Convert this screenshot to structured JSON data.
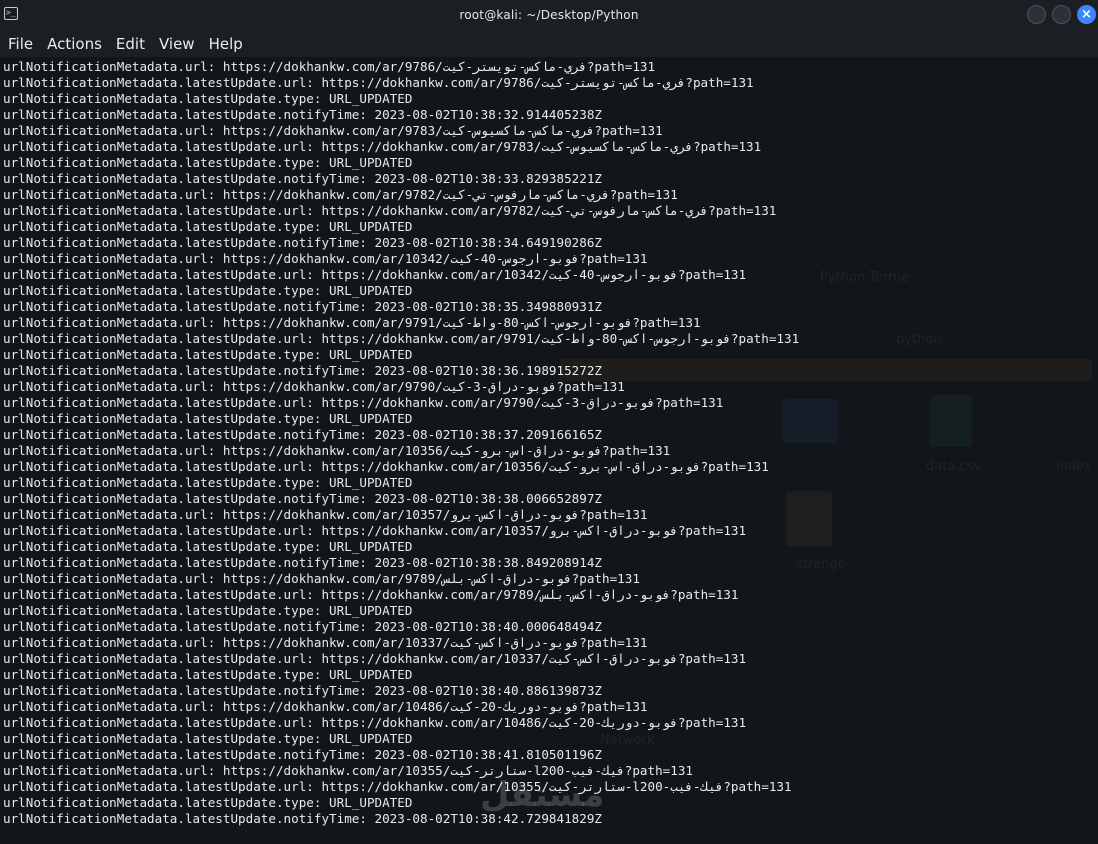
{
  "window": {
    "title": "root@kali: ~/Desktop/Python",
    "terminal_icon": "terminal-icon",
    "close_glyph": "×"
  },
  "menu": [
    "File",
    "Actions",
    "Edit",
    "View",
    "Help"
  ],
  "background_ghost_text": {
    "wallpaper_1": "Python Terroe",
    "path_hint": "python",
    "folder_label": "data.csv",
    "folder2_label": "index",
    "file_label": "strange-",
    "status_hint": "Network"
  },
  "watermark": "مستقل",
  "terminal_lines": [
    "urlNotificationMetadata.url: https://dokhankw.com/ar/9786/فري-ماكس-تويستر-كيت?path=131",
    "urlNotificationMetadata.latestUpdate.url: https://dokhankw.com/ar/9786/فري-ماكس-تويستر-كيت?path=131",
    "urlNotificationMetadata.latestUpdate.type: URL_UPDATED",
    "urlNotificationMetadata.latestUpdate.notifyTime: 2023-08-02T10:38:32.914405238Z",
    "urlNotificationMetadata.url: https://dokhankw.com/ar/9783/فري-ماكس-ماكسيوس-كيت?path=131",
    "urlNotificationMetadata.latestUpdate.url: https://dokhankw.com/ar/9783/فري-ماكس-ماكسيوس-كيت?path=131",
    "urlNotificationMetadata.latestUpdate.type: URL_UPDATED",
    "urlNotificationMetadata.latestUpdate.notifyTime: 2023-08-02T10:38:33.829385221Z",
    "urlNotificationMetadata.url: https://dokhankw.com/ar/9782/فري-ماكس-مارفوس-تي-كيت?path=131",
    "urlNotificationMetadata.latestUpdate.url: https://dokhankw.com/ar/9782/فري-ماكس-مارفوس-تي-كيت?path=131",
    "urlNotificationMetadata.latestUpdate.type: URL_UPDATED",
    "urlNotificationMetadata.latestUpdate.notifyTime: 2023-08-02T10:38:34.649190286Z",
    "urlNotificationMetadata.url: https://dokhankw.com/ar/10342/فوبو-ارجوس-40-كيت?path=131",
    "urlNotificationMetadata.latestUpdate.url: https://dokhankw.com/ar/10342/فوبو-ارجوس-40-كيت?path=131",
    "urlNotificationMetadata.latestUpdate.type: URL_UPDATED",
    "urlNotificationMetadata.latestUpdate.notifyTime: 2023-08-02T10:38:35.349880931Z",
    "urlNotificationMetadata.url: https://dokhankw.com/ar/9791/فوبو-ارجوس-اكس-80-واط-كيت?path=131",
    "urlNotificationMetadata.latestUpdate.url: https://dokhankw.com/ar/9791/فوبو-ارجوس-اكس-80-واط-كيت?path=131",
    "urlNotificationMetadata.latestUpdate.type: URL_UPDATED",
    "urlNotificationMetadata.latestUpdate.notifyTime: 2023-08-02T10:38:36.198915272Z",
    "urlNotificationMetadata.url: https://dokhankw.com/ar/9790/فوبو-دراق-3-كيت?path=131",
    "urlNotificationMetadata.latestUpdate.url: https://dokhankw.com/ar/9790/فوبو-دراق-3-كيت?path=131",
    "urlNotificationMetadata.latestUpdate.type: URL_UPDATED",
    "urlNotificationMetadata.latestUpdate.notifyTime: 2023-08-02T10:38:37.209166165Z",
    "urlNotificationMetadata.url: https://dokhankw.com/ar/10356/فوبو-دراق-اس-برو-كيت?path=131",
    "urlNotificationMetadata.latestUpdate.url: https://dokhankw.com/ar/10356/فوبو-دراق-اس-برو-كيت?path=131",
    "urlNotificationMetadata.latestUpdate.type: URL_UPDATED",
    "urlNotificationMetadata.latestUpdate.notifyTime: 2023-08-02T10:38:38.006652897Z",
    "urlNotificationMetadata.url: https://dokhankw.com/ar/10357/فوبو-دراق-اكس-برو?path=131",
    "urlNotificationMetadata.latestUpdate.url: https://dokhankw.com/ar/10357/فوبو-دراق-اكس-برو?path=131",
    "urlNotificationMetadata.latestUpdate.type: URL_UPDATED",
    "urlNotificationMetadata.latestUpdate.notifyTime: 2023-08-02T10:38:38.849208914Z",
    "urlNotificationMetadata.url: https://dokhankw.com/ar/9789/فوبو-دراق-اكس-بلس?path=131",
    "urlNotificationMetadata.latestUpdate.url: https://dokhankw.com/ar/9789/فوبو-دراق-اكس-بلس?path=131",
    "urlNotificationMetadata.latestUpdate.type: URL_UPDATED",
    "urlNotificationMetadata.latestUpdate.notifyTime: 2023-08-02T10:38:40.000648494Z",
    "urlNotificationMetadata.url: https://dokhankw.com/ar/10337/فوبو-دراق-اكس-كيت?path=131",
    "urlNotificationMetadata.latestUpdate.url: https://dokhankw.com/ar/10337/فوبو-دراق-اكس-كيت?path=131",
    "urlNotificationMetadata.latestUpdate.type: URL_UPDATED",
    "urlNotificationMetadata.latestUpdate.notifyTime: 2023-08-02T10:38:40.886139873Z",
    "urlNotificationMetadata.url: https://dokhankw.com/ar/10486/فوبو-دوريك-20-كيت?path=131",
    "urlNotificationMetadata.latestUpdate.url: https://dokhankw.com/ar/10486/فوبو-دوريك-20-كيت?path=131",
    "urlNotificationMetadata.latestUpdate.type: URL_UPDATED",
    "urlNotificationMetadata.latestUpdate.notifyTime: 2023-08-02T10:38:41.810501196Z",
    "urlNotificationMetadata.url: https://dokhankw.com/ar/10355/ستارتر-كيت-l200-فيك-فيب?path=131",
    "urlNotificationMetadata.latestUpdate.url: https://dokhankw.com/ar/10355/ستارتر-كيت-l200-فيك-فيب?path=131",
    "urlNotificationMetadata.latestUpdate.type: URL_UPDATED",
    "urlNotificationMetadata.latestUpdate.notifyTime: 2023-08-02T10:38:42.729841829Z"
  ]
}
